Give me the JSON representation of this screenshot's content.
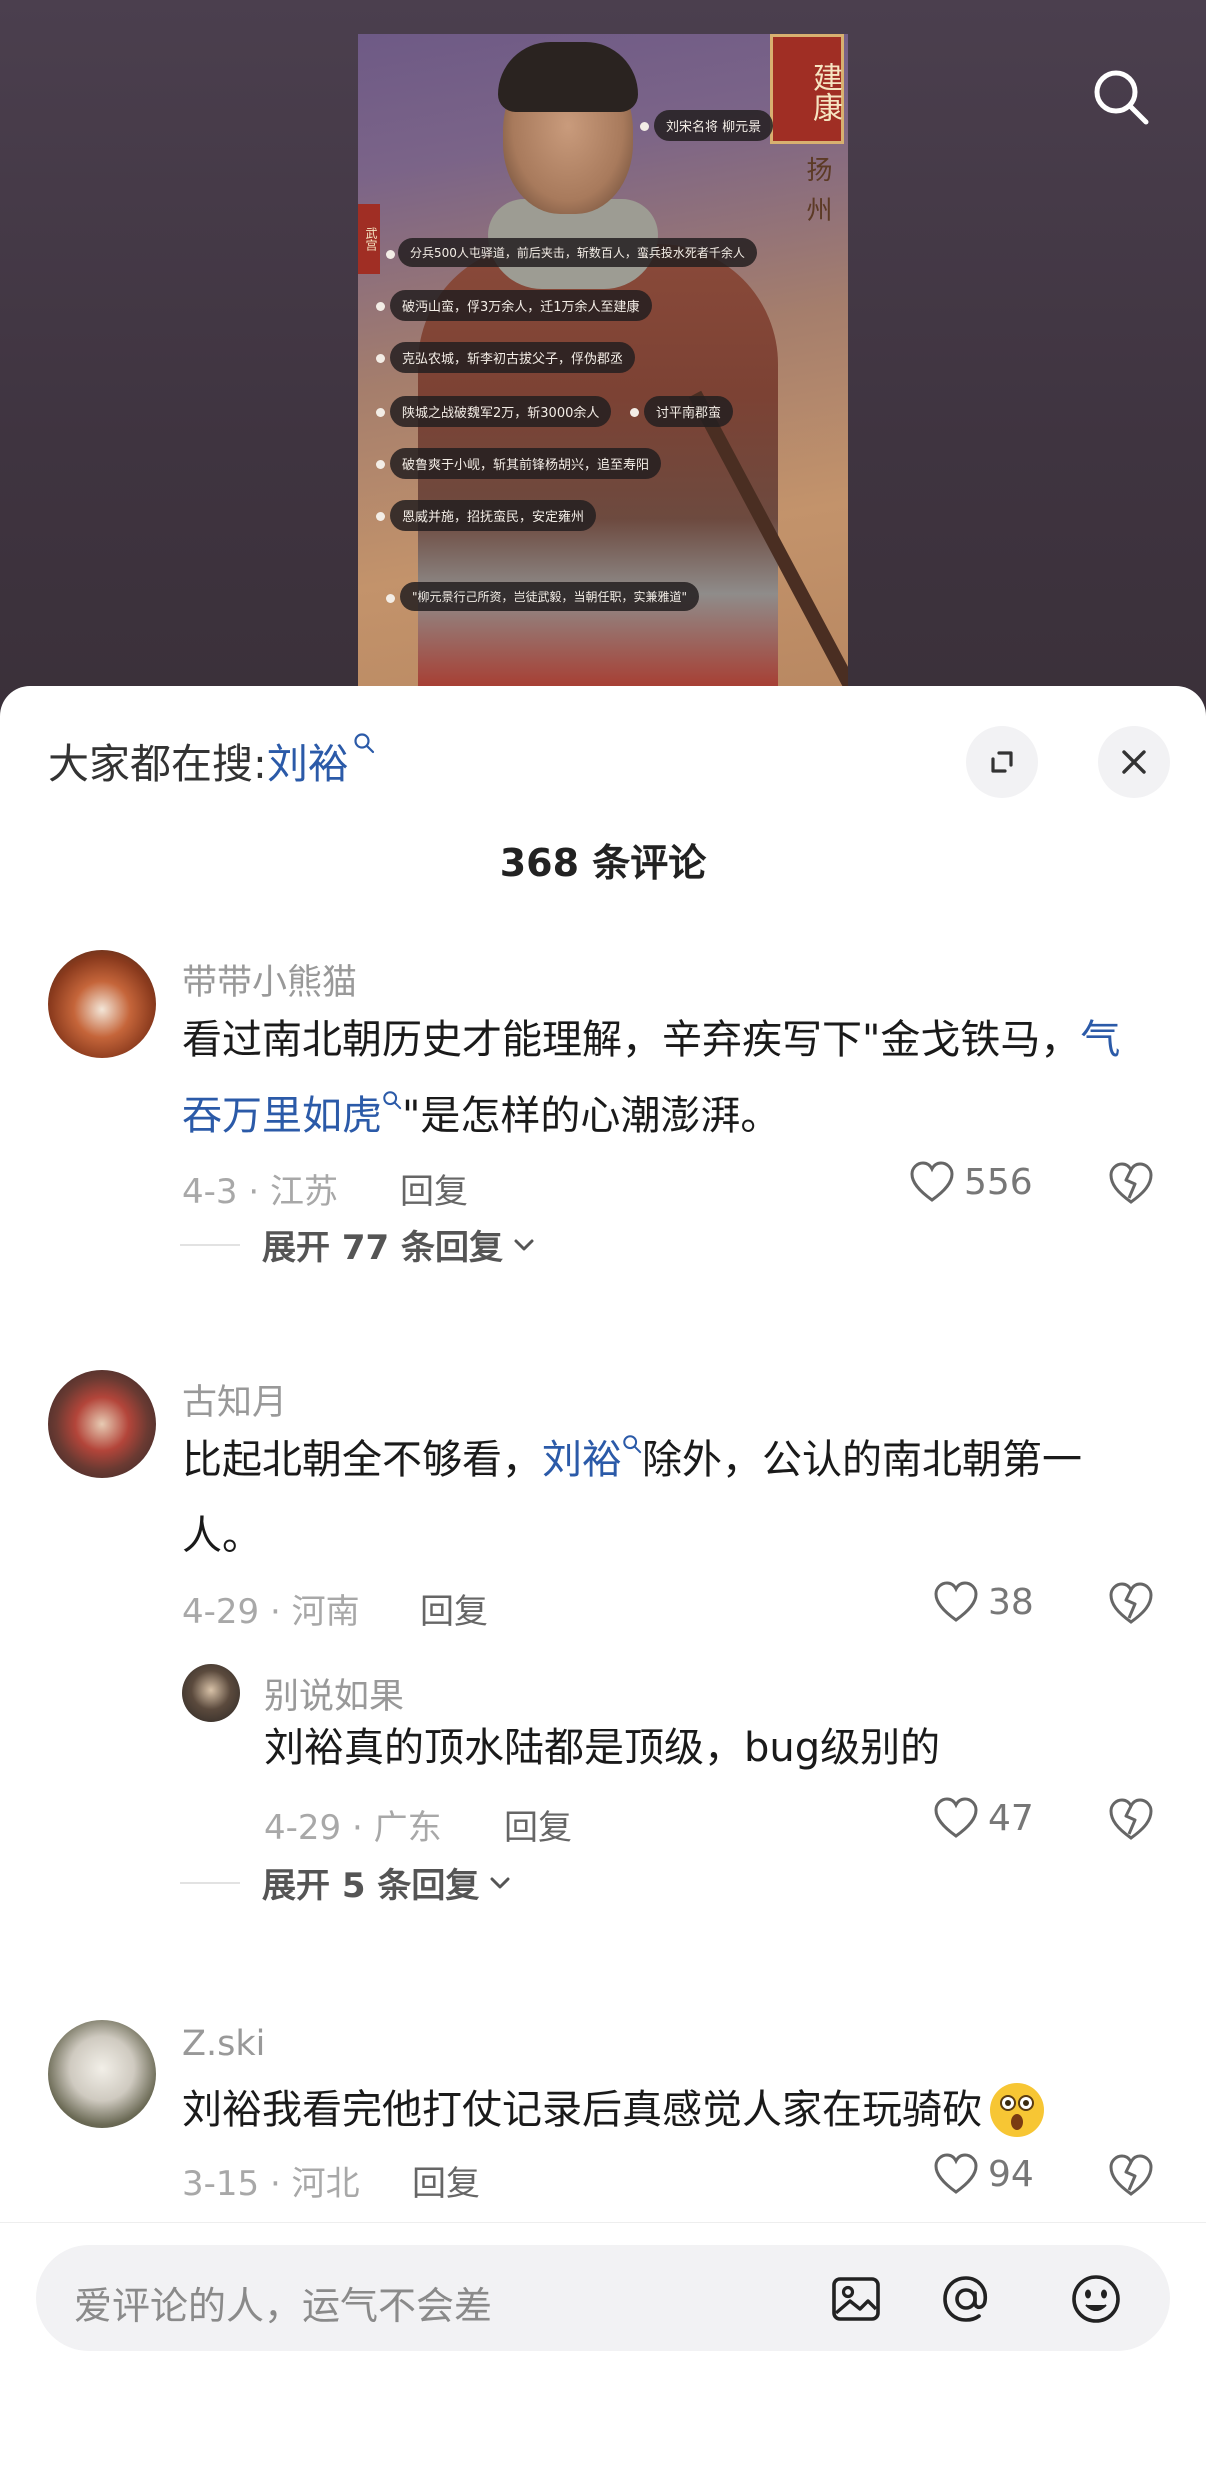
{
  "video": {
    "poster": {
      "tag_title": "建康",
      "tag_side": "扬州",
      "name_label": "刘宋名将 柳元景",
      "events": [
        "分兵500人屯驿道，前后夹击，斩数百人，蛮兵投水死者千余人",
        "破沔山蛮，俘3万余人，迁1万余人至建康",
        "克弘农城，斩李初古拔父子，俘伪郡丞",
        "陕城之战破魏军2万，斩3000余人",
        "讨平南郡蛮",
        "破鲁爽于小岘，斩其前锋杨胡兴，追至寿阳",
        "恩威并施，招抚蛮民，安定雍州",
        "\"柳元景行己所资，岂徒武毅，当朝任职，实兼雅道\""
      ],
      "side_tag": "武宫"
    }
  },
  "sheet": {
    "hot_search_prefix": "大家都在搜:",
    "hot_search_keyword": "刘裕",
    "comment_count": "368 条评论"
  },
  "comments": [
    {
      "user": "带带小熊猫",
      "text_before": "看过南北朝历史才能理解，辛弃疾写下\"金戈铁马，",
      "keyword": "气吞万里如虎",
      "text_after": "\"是怎样的心潮澎湃。",
      "meta": "4-3 · 江苏",
      "reply": "回复",
      "likes": "556",
      "expand": "展开 77 条回复"
    },
    {
      "user": "古知月",
      "text_before": "比起北朝全不够看，",
      "keyword": "刘裕",
      "text_after": "除外，公认的南北朝第一人。",
      "meta": "4-29 · 河南",
      "reply": "回复",
      "likes": "38"
    },
    {
      "user": "别说如果",
      "text": "刘裕真的顶水陆都是顶级，bug级别的",
      "meta": "4-29 · 广东",
      "reply": "回复",
      "likes": "47",
      "expand": "展开 5 条回复"
    },
    {
      "user": "Z.ski",
      "text": "刘裕我看完他打仗记录后真感觉人家在玩骑砍",
      "meta": "3-15 · 河北",
      "reply": "回复",
      "likes": "94"
    }
  ],
  "input": {
    "placeholder": "爱评论的人，运气不会差",
    "icons": [
      "image-icon",
      "at-icon",
      "emoji-icon"
    ]
  },
  "colors": {
    "keyword": "#2b5aa8",
    "meta": "#a8a8a8",
    "username": "#999999"
  }
}
